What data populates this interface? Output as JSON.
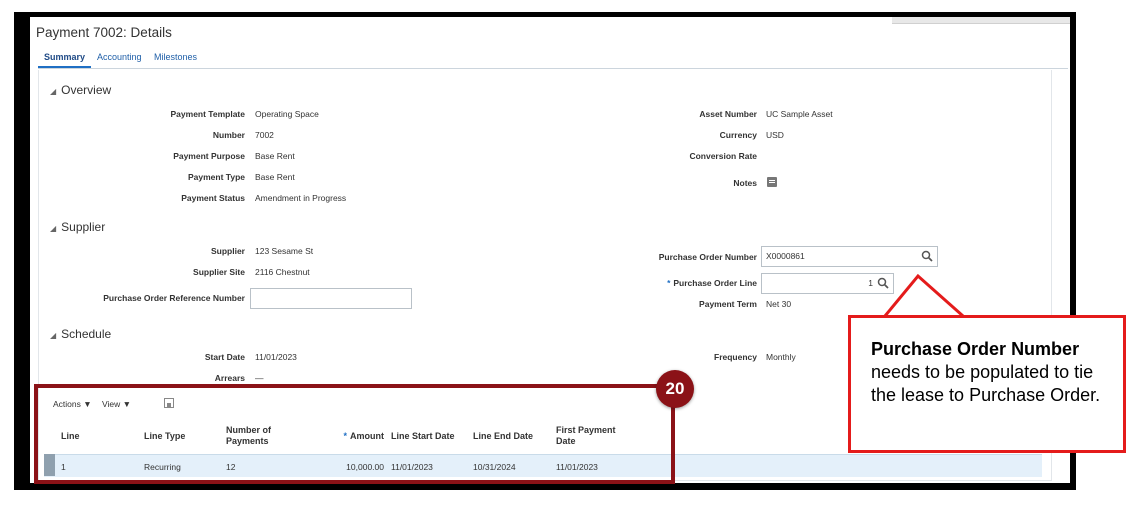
{
  "page": {
    "title": "Payment 7002: Details"
  },
  "tabs": [
    {
      "label": "Summary"
    },
    {
      "label": "Accounting"
    },
    {
      "label": "Milestones"
    }
  ],
  "overview": {
    "heading": "Overview",
    "left": [
      {
        "label": "Payment Template",
        "value": "Operating Space"
      },
      {
        "label": "Number",
        "value": "7002"
      },
      {
        "label": "Payment Purpose",
        "value": "Base Rent"
      },
      {
        "label": "Payment Type",
        "value": "Base Rent"
      },
      {
        "label": "Payment Status",
        "value": "Amendment in Progress"
      }
    ],
    "right": [
      {
        "label": "Asset Number",
        "value": "UC Sample Asset"
      },
      {
        "label": "Currency",
        "value": "USD"
      },
      {
        "label": "Conversion Rate",
        "value": ""
      },
      {
        "label": "Notes",
        "icon": "notes-icon"
      }
    ]
  },
  "supplier": {
    "heading": "Supplier",
    "supplier_label": "Supplier",
    "supplier_value": "123 Sesame St",
    "site_label": "Supplier Site",
    "site_value": "2116 Chestnut",
    "po_ref_label": "Purchase Order Reference Number",
    "po_ref_value": "",
    "po_number_label": "Purchase Order Number",
    "po_number_value": "X0000861",
    "po_line_label": "Purchase Order Line",
    "po_line_value": "1",
    "payment_term_label": "Payment Term",
    "payment_term_value": "Net 30"
  },
  "schedule": {
    "heading": "Schedule",
    "start_date_label": "Start Date",
    "start_date_value": "11/01/2023",
    "arrears_label": "Arrears",
    "arrears_value": "—",
    "frequency_label": "Frequency",
    "frequency_value": "Monthly"
  },
  "table": {
    "actions_label": "Actions ▼",
    "view_label": "View ▼",
    "detach_icon": "detach-icon",
    "columns": [
      "Line",
      "Line Type",
      "Number of Payments",
      "Amount",
      "Line Start Date",
      "Line End Date",
      "First Payment Date"
    ],
    "rows": [
      {
        "line": "1",
        "line_type": "Recurring",
        "number_of_payments": "12",
        "amount": "10,000.00",
        "line_start_date": "11/01/2023",
        "line_end_date": "10/31/2024",
        "first_payment_date": "11/01/2023"
      }
    ]
  },
  "annotation": {
    "step_number": "20",
    "callout_bold": "Purchase Order Number",
    "callout_rest": " needs to be populated to tie the lease to Purchase Order.",
    "colors": {
      "callout_border": "#e41b1b",
      "step_box": "#8b1217"
    }
  }
}
